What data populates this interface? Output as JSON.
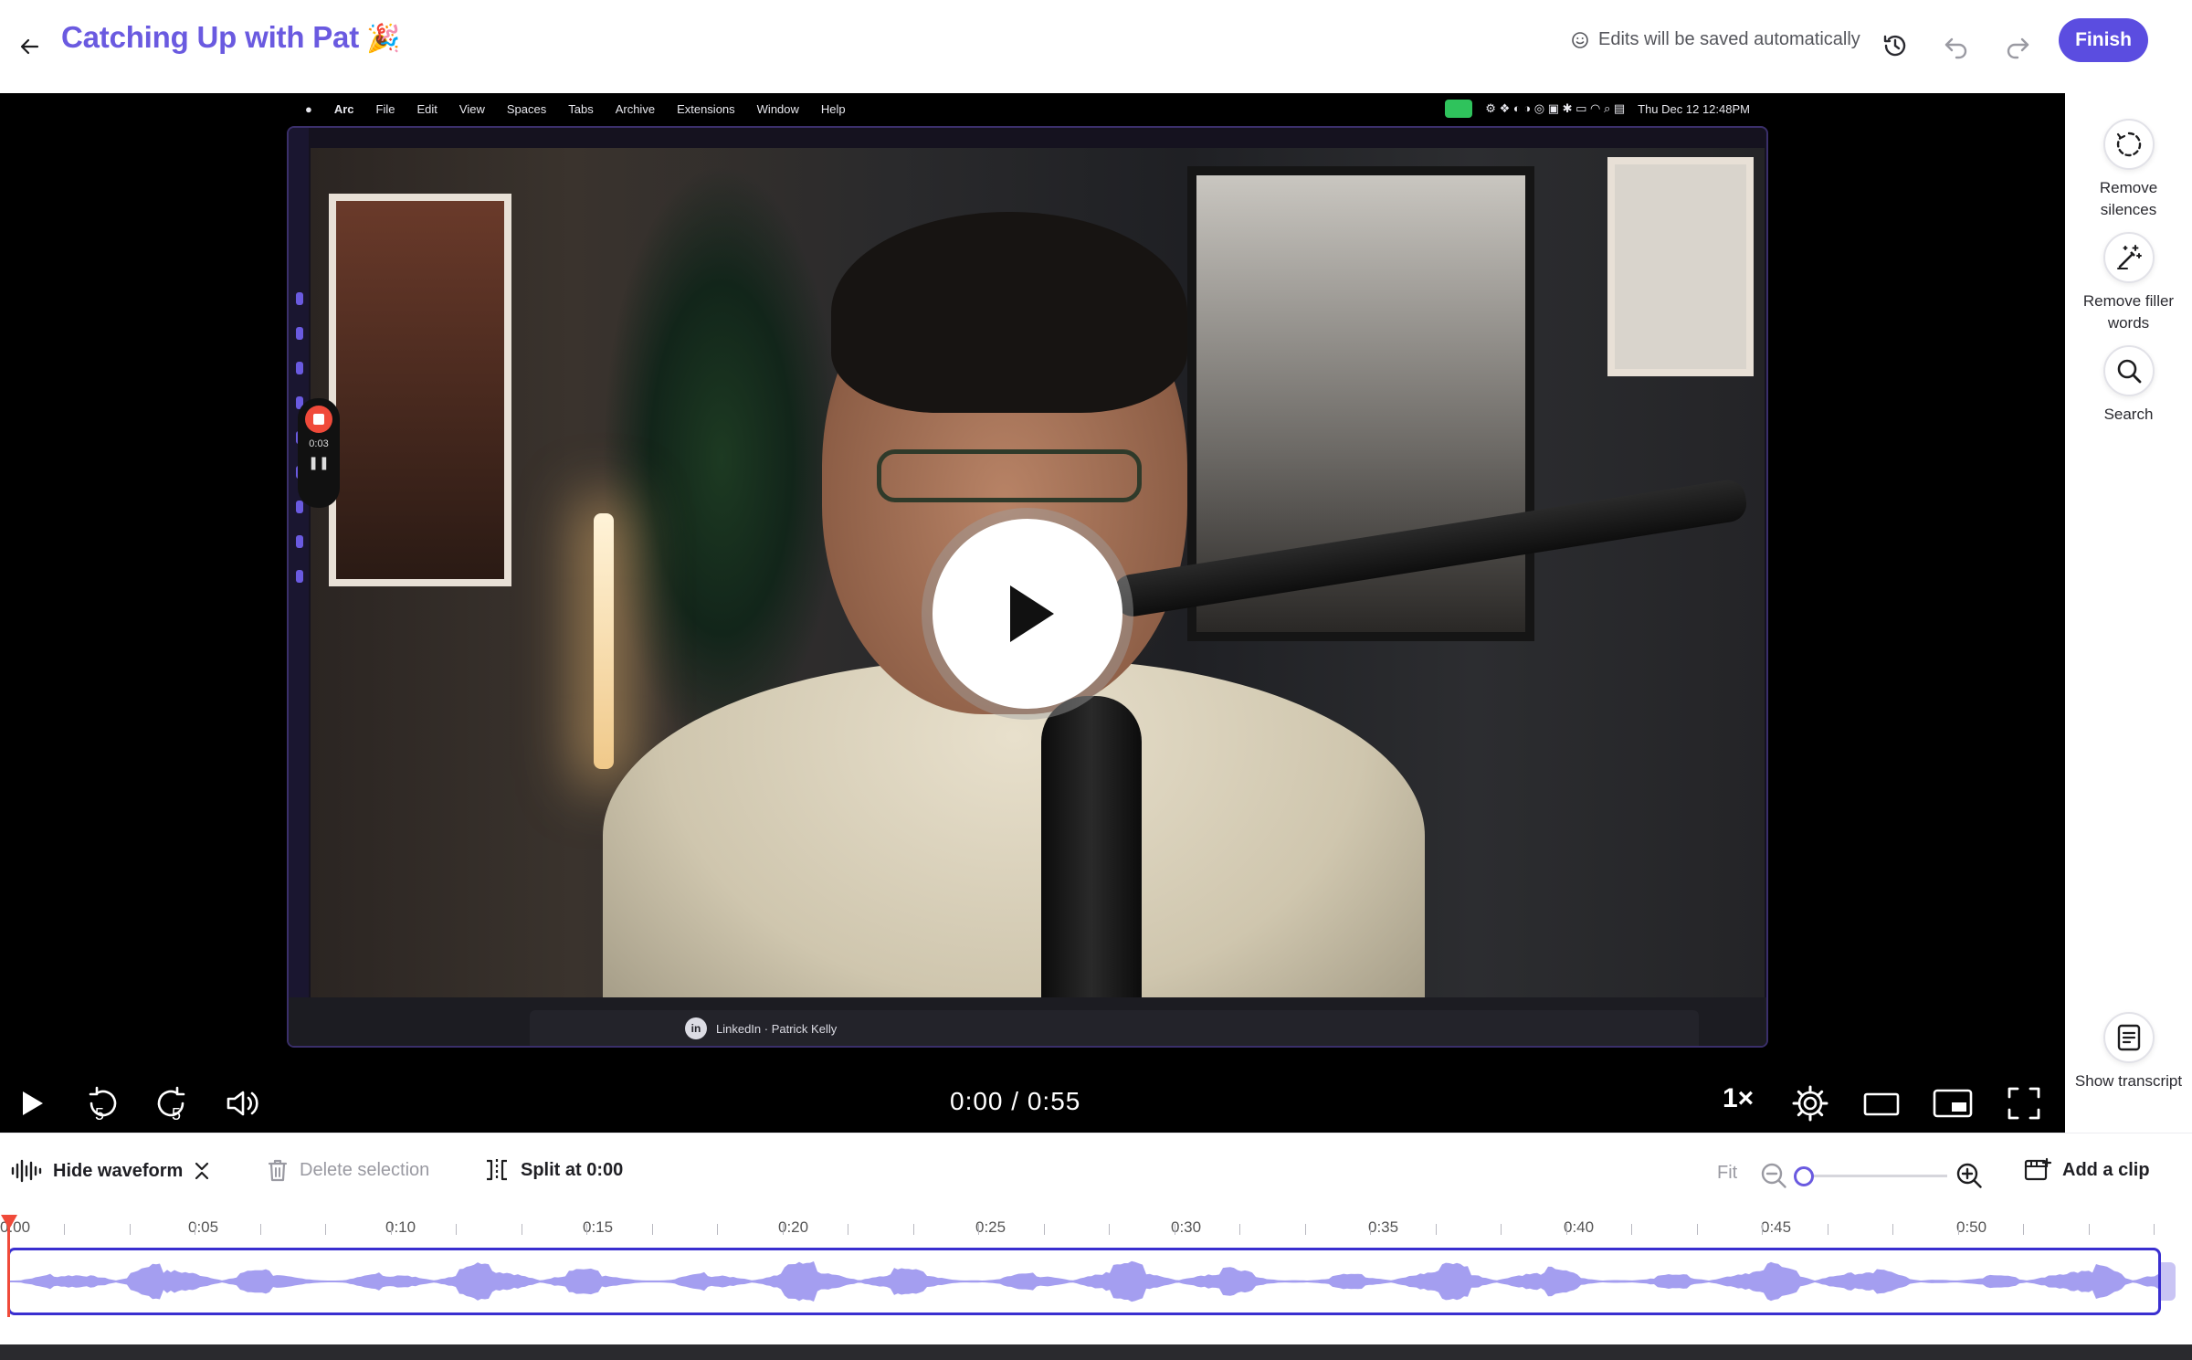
{
  "header": {
    "title": "Catching Up with Pat",
    "title_emoji": "🎉",
    "autosave_text": "Edits will be saved automatically",
    "finish_label": "Finish"
  },
  "screen_recording": {
    "menubar_items": [
      "",
      "Arc",
      "File",
      "Edit",
      "View",
      "Spaces",
      "Tabs",
      "Archive",
      "Extensions",
      "Window",
      "Help"
    ],
    "clock": "Thu Dec 12  12:48PM",
    "recorder_time": "0:03",
    "linkedin_tab": "LinkedIn · Patrick Kelly",
    "linkedin_icon": "in"
  },
  "player": {
    "current_time": "0:00",
    "separator": "/",
    "duration": "0:55",
    "skip_back_seconds": "5",
    "skip_forward_seconds": "5",
    "speed": "1×"
  },
  "tools": {
    "remove_silences": "Remove silences",
    "remove_filler_words": "Remove filler words",
    "search": "Search",
    "show_transcript": "Show transcript"
  },
  "timeline": {
    "hide_waveform": "Hide waveform",
    "delete_selection": "Delete selection",
    "split_at": "Split at 0:00",
    "fit": "Fit",
    "add_clip": "Add a clip",
    "zoom_level": 0,
    "ruler_labels": [
      "0:00",
      "0:05",
      "0:10",
      "0:15",
      "0:20",
      "0:25",
      "0:30",
      "0:35",
      "0:40",
      "0:45",
      "0:50"
    ]
  },
  "colors": {
    "accent": "#5b4de0",
    "title": "#6a5ae0",
    "waveform": "#a49ef0",
    "playhead": "#f04a3a"
  }
}
